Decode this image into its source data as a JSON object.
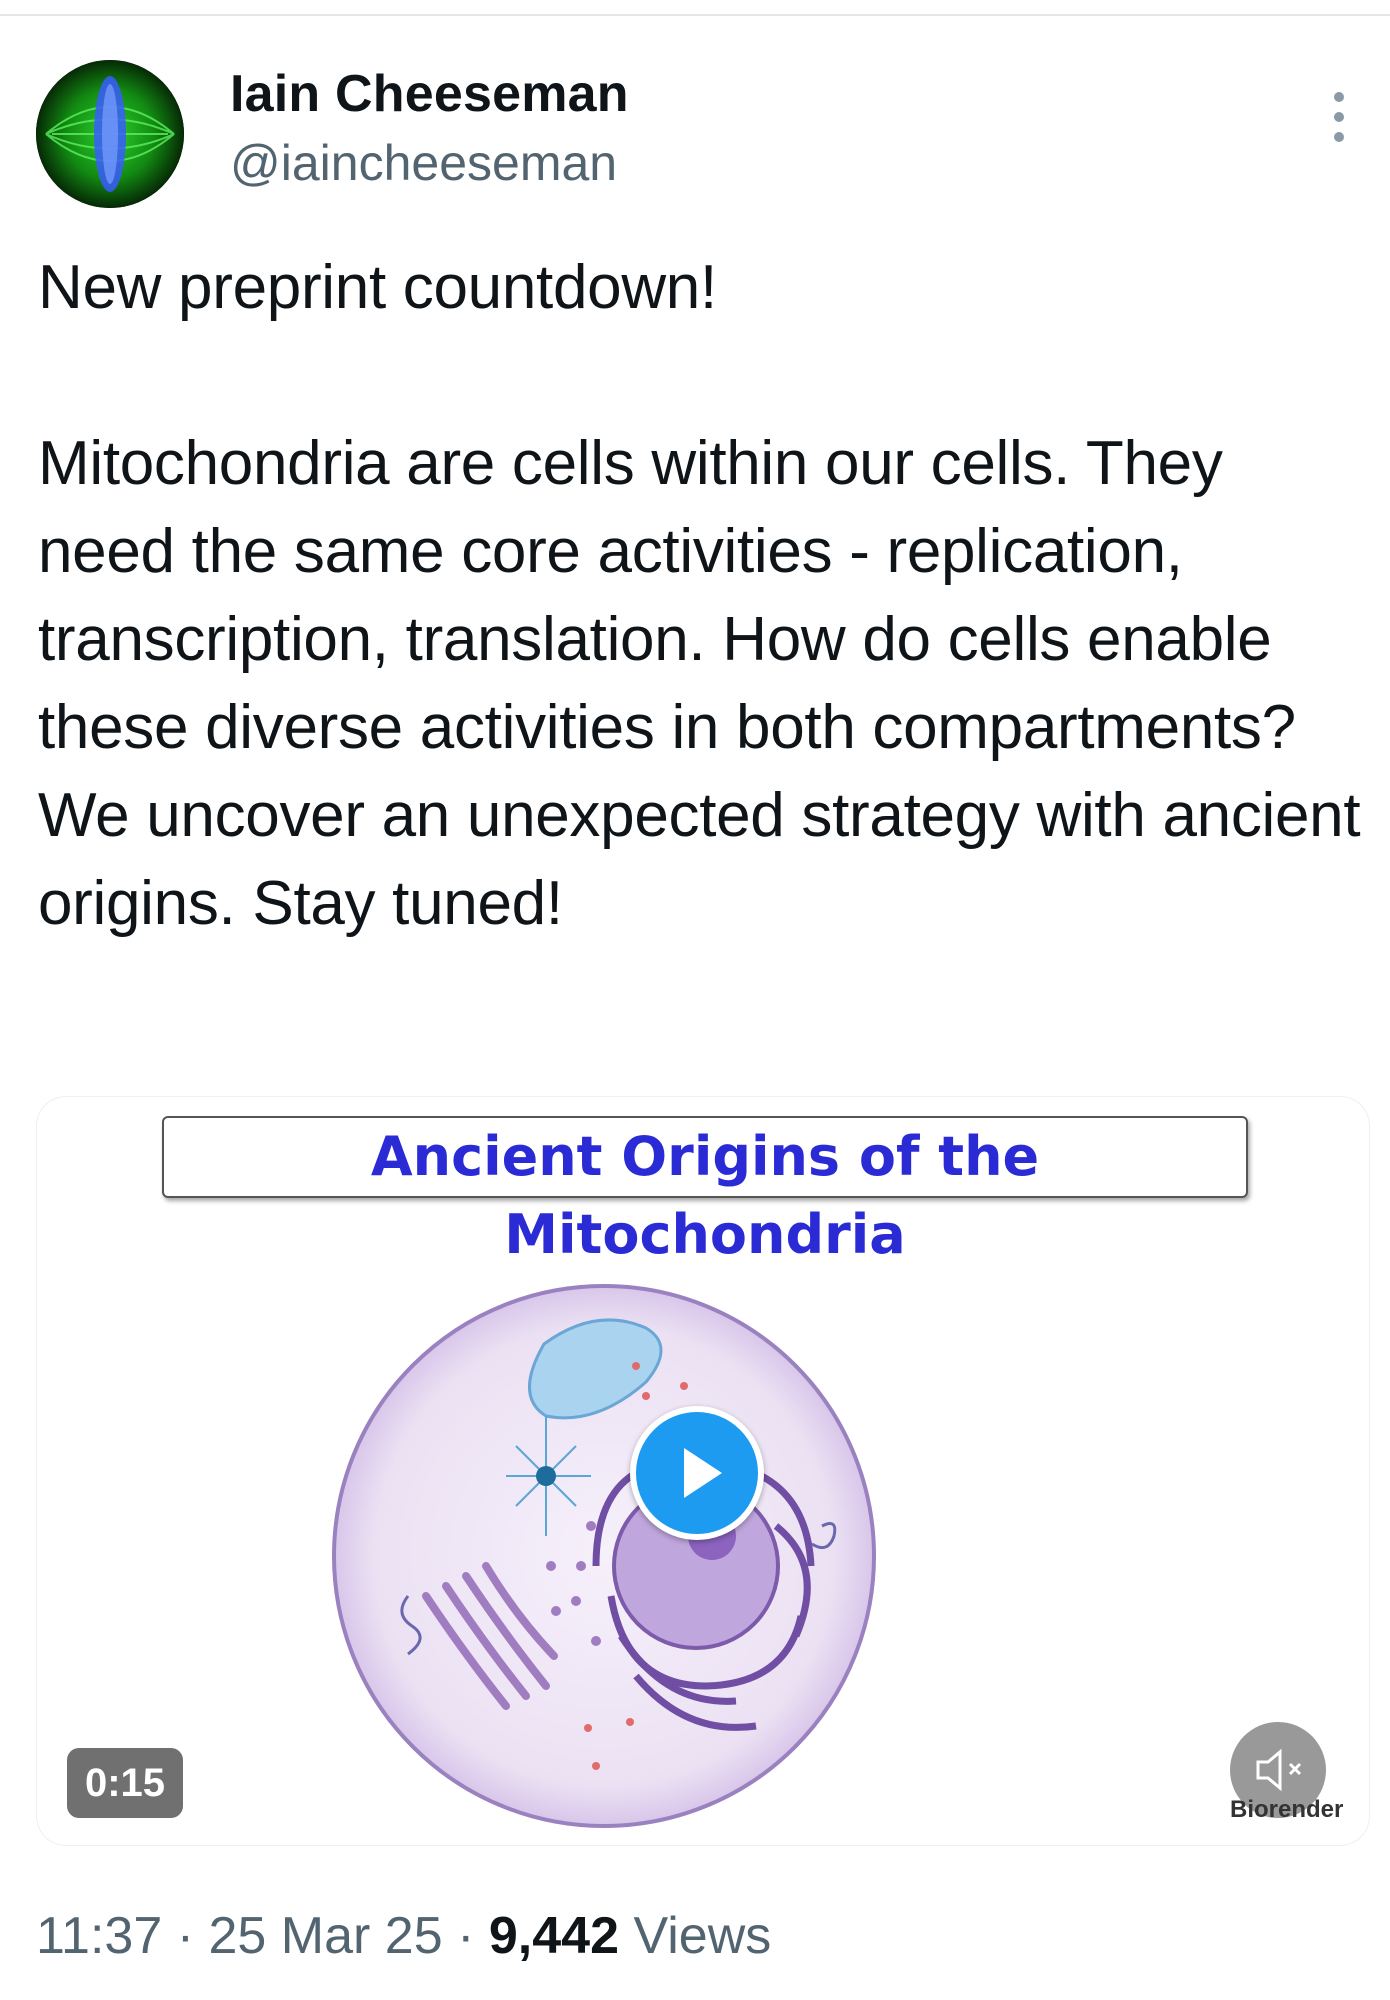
{
  "author": {
    "name": "Iain Cheeseman",
    "handle": "@iaincheeseman"
  },
  "tweet": {
    "text": "New preprint countdown!\n\nMitochondria are cells within our cells. They need the same core activities - replication, transcription, translation. How do cells enable these diverse activities in both compartments? We uncover an unexpected strategy with ancient origins. Stay tuned!"
  },
  "media": {
    "video_title": "Ancient Origins of the Mitochondria",
    "duration": "0:15",
    "watermark": "Biorender",
    "play_icon": "play-icon",
    "mute_icon": "speaker-muted-icon"
  },
  "meta": {
    "time": "11:37",
    "separator": "·",
    "date": "25 Mar 25",
    "views_count": "9,442",
    "views_label": "Views"
  },
  "colors": {
    "accent": "#1d9bf0",
    "title_blue": "#2b2bd6",
    "muted_text": "#536471"
  }
}
